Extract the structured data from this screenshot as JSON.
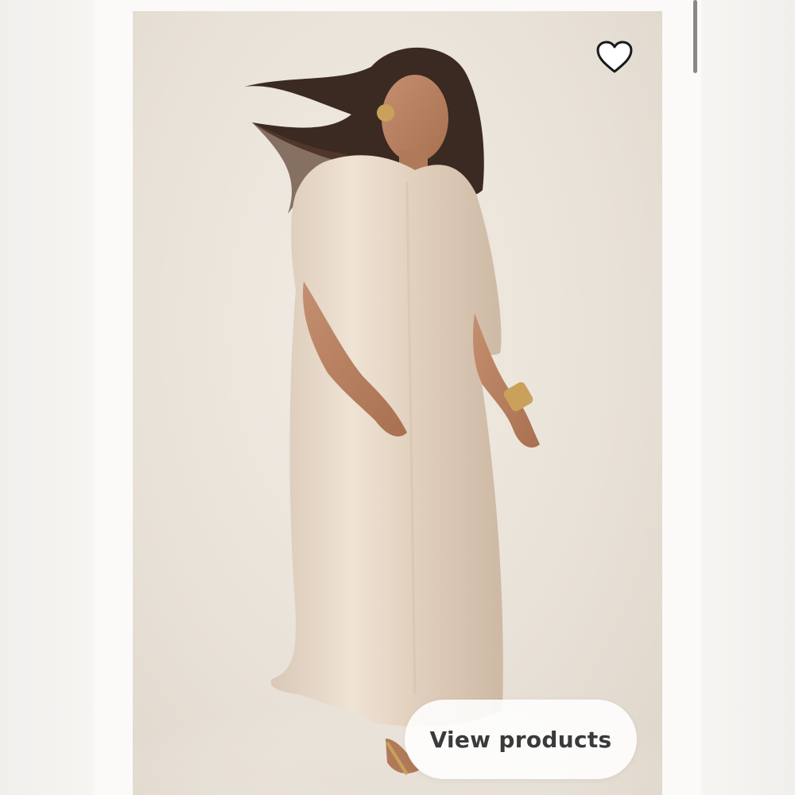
{
  "card": {
    "image_description_icon": "fashion-photo",
    "favorite_icon": "heart-outline-icon",
    "cta_label": "View products"
  },
  "colors": {
    "page_background": "#f6f4f1",
    "card_background": "#e8e1d7",
    "cta_background": "#ffffff",
    "cta_text": "#3a3a3a",
    "scrollbar": "#8a8784"
  }
}
